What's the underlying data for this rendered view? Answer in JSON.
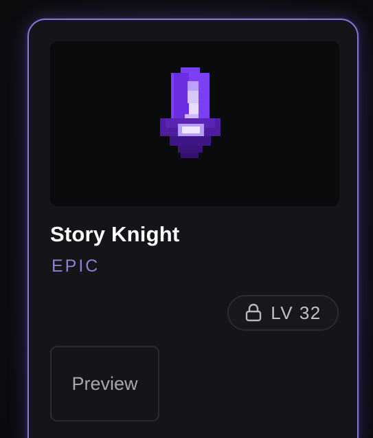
{
  "card": {
    "title": "Story Knight",
    "rarity": "EPIC",
    "item_icon": "purple-crystal-sword-icon",
    "accent_color": "#8a78d6",
    "rarity_color": "#8f7fd6"
  },
  "level": {
    "icon": "lock-icon",
    "label": "LV 32"
  },
  "actions": {
    "preview_label": "Preview"
  }
}
